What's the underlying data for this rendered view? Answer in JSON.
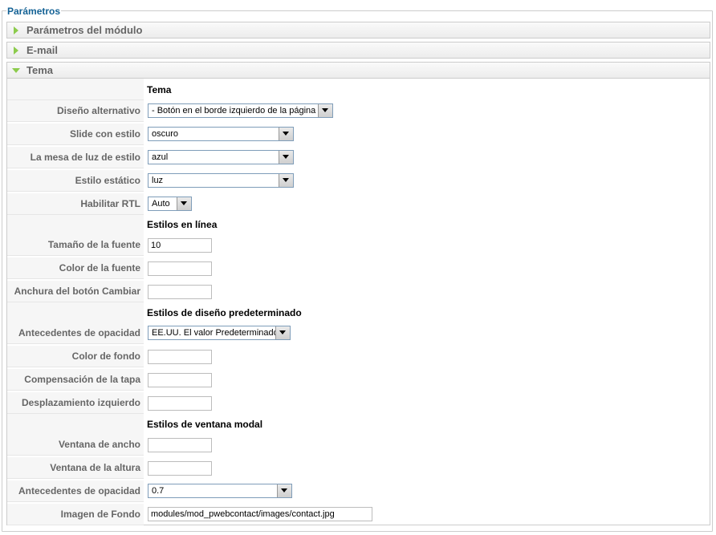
{
  "legend": "Parámetros",
  "panels": [
    {
      "title": "Parámetros del módulo"
    },
    {
      "title": "E-mail"
    },
    {
      "title": "Tema"
    }
  ],
  "sections": {
    "tema": "Tema",
    "estilos_linea": "Estilos en línea",
    "estilos_diseno": "Estilos de diseño predeterminado",
    "estilos_modal": "Estilos de ventana modal"
  },
  "fields": {
    "diseno_alternativo": {
      "label": "Diseño alternativo",
      "value": "- Botón en el borde izquierdo de la página"
    },
    "slide_estilo": {
      "label": "Slide con estilo",
      "value": "oscuro"
    },
    "mesa_luz": {
      "label": "La mesa de luz de estilo",
      "value": "azul"
    },
    "estilo_estatico": {
      "label": "Estilo estático",
      "value": "luz"
    },
    "habilitar_rtl": {
      "label": "Habilitar RTL",
      "value": "Auto"
    },
    "tamano_fuente": {
      "label": "Tamaño de la fuente",
      "value": "10"
    },
    "color_fuente": {
      "label": "Color de la fuente",
      "value": ""
    },
    "anchura_boton": {
      "label": "Anchura del botón Cambiar",
      "value": ""
    },
    "antecedentes_opacidad_1": {
      "label": "Antecedentes de opacidad",
      "value": "EE.UU. El valor Predeterminado"
    },
    "color_fondo": {
      "label": "Color de fondo",
      "value": ""
    },
    "compensacion_tapa": {
      "label": "Compensación de la tapa",
      "value": ""
    },
    "desplazamiento_izq": {
      "label": "Desplazamiento izquierdo",
      "value": ""
    },
    "ventana_ancho": {
      "label": "Ventana de ancho",
      "value": ""
    },
    "ventana_altura": {
      "label": "Ventana de la altura",
      "value": ""
    },
    "antecedentes_opacidad_2": {
      "label": "Antecedentes de opacidad",
      "value": "0.7"
    },
    "imagen_fondo": {
      "label": "Imagen de Fondo",
      "value": "modules/mod_pwebcontact/images/contact.jpg"
    }
  },
  "colors": {
    "accent": "#146295",
    "triangle": "#8ccb4c"
  }
}
